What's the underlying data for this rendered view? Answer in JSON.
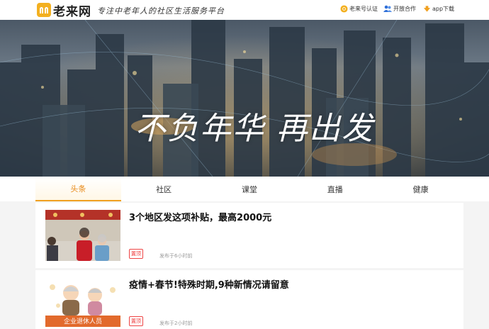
{
  "header": {
    "logo_text": "老来网",
    "slogan": "专注中老年人的社区生活服务平台",
    "links": [
      {
        "label": "老来号认证",
        "icon": "sun-badge-icon"
      },
      {
        "label": "开放合作",
        "icon": "users-icon"
      },
      {
        "label": "app下载",
        "icon": "download-icon"
      }
    ]
  },
  "banner": {
    "title": "不负年华 再出发"
  },
  "tabs": [
    {
      "label": "头条",
      "active": true
    },
    {
      "label": "社区",
      "active": false
    },
    {
      "label": "课堂",
      "active": false
    },
    {
      "label": "直播",
      "active": false
    },
    {
      "label": "健康",
      "active": false
    }
  ],
  "articles": [
    {
      "title": "3个地区发这项补贴，最高2000元",
      "tag": "置顶",
      "time": "发布于6小时前",
      "thumb_caption": ""
    },
    {
      "title": "疫情+春节!特殊时期,9种新情况请留意",
      "tag": "置顶",
      "time": "发布于2小时前",
      "thumb_caption": "企业退休人员"
    }
  ],
  "colors": {
    "accent": "#f0a020",
    "tag_red": "#e33333",
    "logo_yellow": "#f3b020"
  }
}
